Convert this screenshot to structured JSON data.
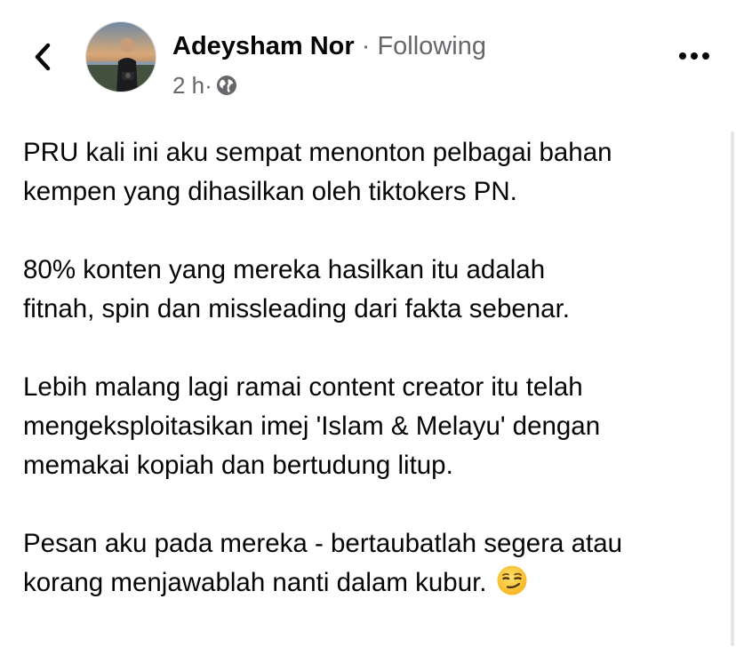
{
  "header": {
    "author_name": "Adeysham Nor",
    "separator": " · ",
    "follow_status": "Following",
    "time_ago": "2 h",
    "meta_separator": " · ",
    "audience_icon": "globe-icon",
    "back_icon": "chevron-left-icon",
    "more_icon": "more-options-icon"
  },
  "post": {
    "paragraphs": [
      {
        "lines": [
          "PRU kali ini aku sempat menonton pelbagai bahan",
          "kempen yang dihasilkan oleh tiktokers PN."
        ]
      },
      {
        "lines": [
          "80% konten yang mereka hasilkan itu adalah",
          "fitnah, spin dan missleading dari fakta sebenar."
        ]
      },
      {
        "lines": [
          "Lebih malang lagi ramai content creator itu telah",
          "mengeksploitasikan imej 'Islam & Melayu' dengan",
          "memakai kopiah dan bertudung litup."
        ]
      },
      {
        "lines": [
          "Pesan aku pada mereka - bertaubatlah segera atau",
          "korang menjawablah nanti dalam kubur."
        ],
        "trailing_emoji": "smirking-face-emoji"
      }
    ]
  },
  "colors": {
    "primary_text": "#050505",
    "secondary_text": "#65676b",
    "background": "#ffffff"
  }
}
